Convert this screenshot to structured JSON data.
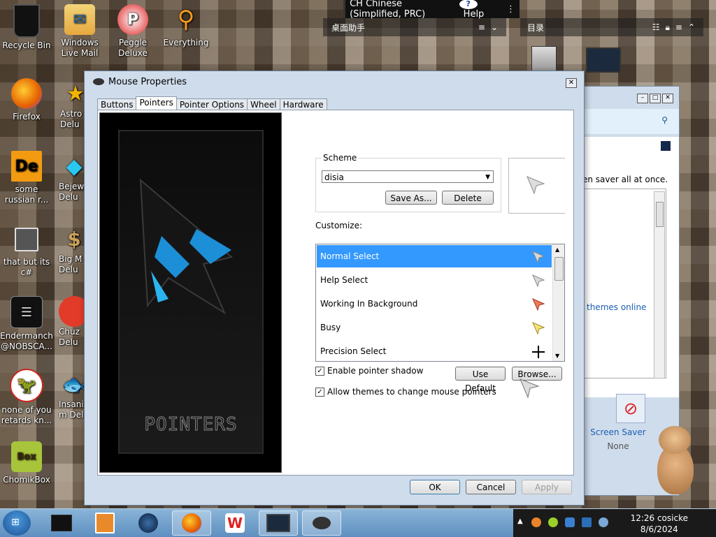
{
  "desktop": {
    "icons": [
      {
        "label": "Recycle Bin",
        "icon": "recycle-bin-icon"
      },
      {
        "label": "Windows Live Mail",
        "icon": "mail-icon"
      },
      {
        "label": "Peggle Deluxe",
        "icon": "peggle-icon"
      },
      {
        "label": "Everything",
        "icon": "magnifier-icon"
      },
      {
        "label": "Firefox",
        "icon": "firefox-icon"
      },
      {
        "label": "Astro Delu",
        "icon": "star-icon"
      },
      {
        "label": "some russian r...",
        "icon": "de-icon"
      },
      {
        "label": "Bejew Delu",
        "icon": "gem-icon"
      },
      {
        "label": "that but its c#",
        "icon": "windows-stack-icon"
      },
      {
        "label": "Big M Delu",
        "icon": "money-bag-icon"
      },
      {
        "label": "Endermanch @NOBSCA...",
        "icon": "notes-icon"
      },
      {
        "label": "Chuz Delu",
        "icon": "puffle-icon"
      },
      {
        "label": "none of you retards kn...",
        "icon": "dino-icon"
      },
      {
        "label": "Insanio m Del",
        "icon": "fish-icon"
      },
      {
        "label": "ChomikBox",
        "icon": "hamster-box-icon"
      }
    ]
  },
  "ime_bar": {
    "language": "CH Chinese (Simplified, PRC)",
    "help": "Help"
  },
  "widgets": {
    "desktop_helper": "桌面助手",
    "catalog": "目录"
  },
  "background_window": {
    "text1": "en saver all at once.",
    "link": "themes online",
    "screen_saver_label": "Screen Saver",
    "screen_saver_value": "None"
  },
  "dialog": {
    "title": "Mouse Properties",
    "tabs": [
      "Buttons",
      "Pointers",
      "Pointer Options",
      "Wheel",
      "Hardware"
    ],
    "active_tab": "Pointers",
    "preview_word": "POINTERS",
    "scheme": {
      "label": "Scheme",
      "value": "disia",
      "save_as": "Save As...",
      "delete": "Delete"
    },
    "customize_label": "Customize:",
    "pointers": [
      {
        "name": "Normal Select",
        "icon": "arrow-cursor-icon",
        "selected": true
      },
      {
        "name": "Help Select",
        "icon": "help-cursor-icon",
        "selected": false
      },
      {
        "name": "Working In Background",
        "icon": "working-cursor-icon",
        "selected": false
      },
      {
        "name": "Busy",
        "icon": "busy-cursor-icon",
        "selected": false
      },
      {
        "name": "Precision Select",
        "icon": "crosshair-cursor-icon",
        "selected": false
      }
    ],
    "enable_shadow": {
      "label": "Enable pointer shadow",
      "checked": true
    },
    "allow_themes": {
      "label": "Allow themes to change mouse pointers",
      "checked": true
    },
    "use_default": "Use Default",
    "browse": "Browse...",
    "ok": "OK",
    "cancel": "Cancel",
    "apply": "Apply"
  },
  "taskbar": {
    "time": "12:26 cosicke",
    "date": "8/6/2024"
  },
  "colors": {
    "selection": "#3399ff",
    "dialog_bg": "#cfdceb",
    "taskbar": "#6f9ccb"
  }
}
